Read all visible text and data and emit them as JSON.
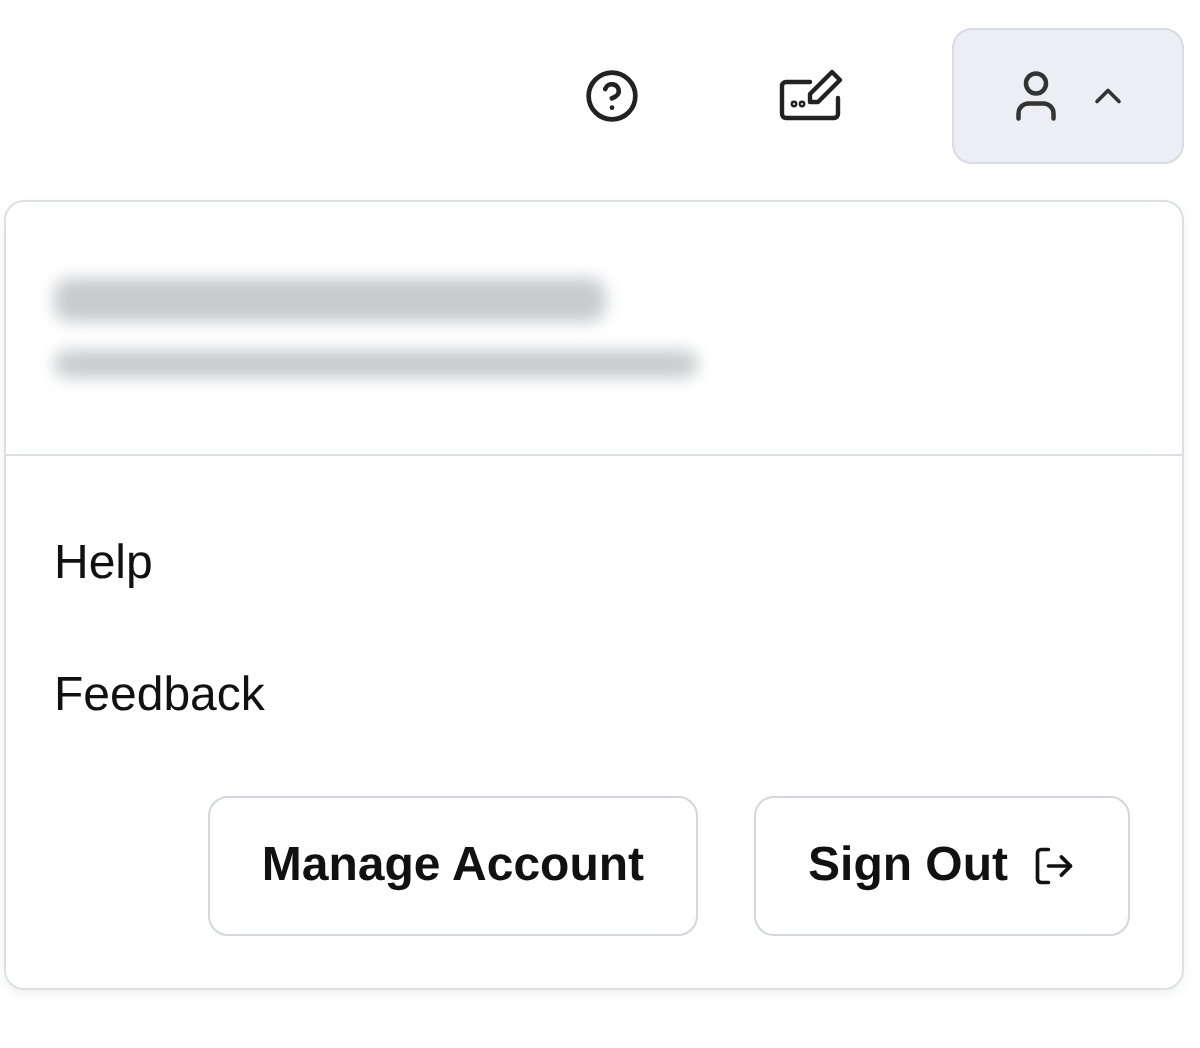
{
  "account_menu": {
    "expanded": true,
    "items": [
      {
        "label": "Help"
      },
      {
        "label": "Feedback"
      }
    ],
    "buttons": [
      {
        "label": "Manage Account",
        "kind": "plain"
      },
      {
        "label": "Sign Out",
        "kind": "signout"
      }
    ]
  }
}
